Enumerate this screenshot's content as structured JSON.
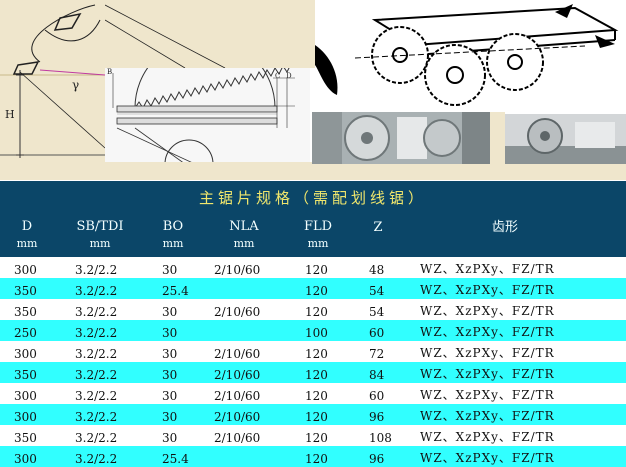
{
  "figure": {
    "angle_labels": {
      "height": "H",
      "gamma": "γ"
    },
    "blade_labels": {
      "b": "B",
      "c": "C",
      "d": "D"
    }
  },
  "table": {
    "title": "主锯片规格（需配划线锯）",
    "headers": [
      {
        "name": "D",
        "unit": "mm"
      },
      {
        "name": "SB/TDI",
        "unit": "mm"
      },
      {
        "name": "BO",
        "unit": "mm"
      },
      {
        "name": "NLA",
        "unit": "mm"
      },
      {
        "name": "FLD",
        "unit": "mm"
      },
      {
        "name": "Z",
        "unit": ""
      },
      {
        "name": "齿形",
        "unit": ""
      }
    ],
    "rows": [
      {
        "d": "300",
        "sb": "3.2/2.2",
        "bo": "30",
        "nla": "2/10/60",
        "fld": "120",
        "z": "48",
        "teeth": "WZ、XzPXy、FZ/TR",
        "bg": "white"
      },
      {
        "d": "350",
        "sb": "3.2/2.2",
        "bo": "25.4",
        "nla": "",
        "fld": "120",
        "z": "54",
        "teeth": "WZ、XzPXy、FZ/TR",
        "bg": "cyan"
      },
      {
        "d": "350",
        "sb": "3.2/2.2",
        "bo": "30",
        "nla": "2/10/60",
        "fld": "120",
        "z": "54",
        "teeth": "WZ、XzPXy、FZ/TR",
        "bg": "white"
      },
      {
        "d": "250",
        "sb": "3.2/2.2",
        "bo": "30",
        "nla": "",
        "fld": "100",
        "z": "60",
        "teeth": "WZ、XzPXy、FZ/TR",
        "bg": "cyan"
      },
      {
        "d": "300",
        "sb": "3.2/2.2",
        "bo": "30",
        "nla": "2/10/60",
        "fld": "120",
        "z": "72",
        "teeth": "WZ、XzPXy、FZ/TR",
        "bg": "white"
      },
      {
        "d": "350",
        "sb": "3.2/2.2",
        "bo": "30",
        "nla": "2/10/60",
        "fld": "120",
        "z": "84",
        "teeth": "WZ、XzPXy、FZ/TR",
        "bg": "cyan"
      },
      {
        "d": "300",
        "sb": "3.2/2.2",
        "bo": "30",
        "nla": "2/10/60",
        "fld": "120",
        "z": "60",
        "teeth": "WZ、XzPXy、FZ/TR",
        "bg": "white"
      },
      {
        "d": "300",
        "sb": "3.2/2.2",
        "bo": "30",
        "nla": "2/10/60",
        "fld": "120",
        "z": "96",
        "teeth": "WZ、XzPXy、FZ/TR",
        "bg": "cyan"
      },
      {
        "d": "350",
        "sb": "3.2/2.2",
        "bo": "30",
        "nla": "2/10/60",
        "fld": "120",
        "z": "108",
        "teeth": "WZ、XzPXy、FZ/TR",
        "bg": "white"
      },
      {
        "d": "300",
        "sb": "3.2/2.2",
        "bo": "25.4",
        "nla": "",
        "fld": "120",
        "z": "96",
        "teeth": "WZ、XzPXy、FZ/TR",
        "bg": "cyan"
      }
    ]
  }
}
